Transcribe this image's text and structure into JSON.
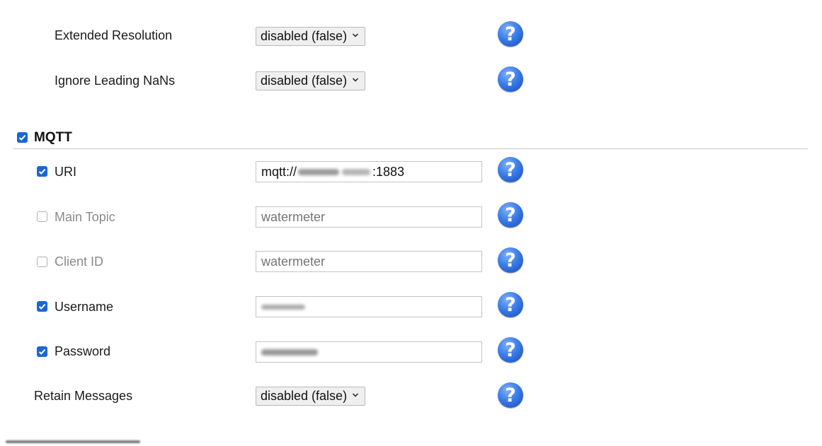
{
  "extended_resolution": {
    "label": "Extended Resolution",
    "value": "disabled (false)"
  },
  "ignore_leading_nans": {
    "label": "Ignore Leading NaNs",
    "value": "disabled (false)"
  },
  "mqtt": {
    "title": "MQTT",
    "enabled": true,
    "uri": {
      "label": "URI",
      "enabled": true,
      "value_suffix": ":1883",
      "value_prefix": "mqtt://"
    },
    "main_topic": {
      "label": "Main Topic",
      "enabled": false,
      "placeholder": "watermeter"
    },
    "client_id": {
      "label": "Client ID",
      "enabled": false,
      "placeholder": "watermeter"
    },
    "username": {
      "label": "Username",
      "enabled": true
    },
    "password": {
      "label": "Password",
      "enabled": true
    },
    "retain_messages": {
      "label": "Retain Messages",
      "value": "disabled (false)"
    }
  },
  "icons": {
    "help": "help-question-icon",
    "checkbox_checked": "check-icon"
  },
  "colors": {
    "accent": "#1a66d6",
    "help_icon": "#2f6fe0"
  }
}
